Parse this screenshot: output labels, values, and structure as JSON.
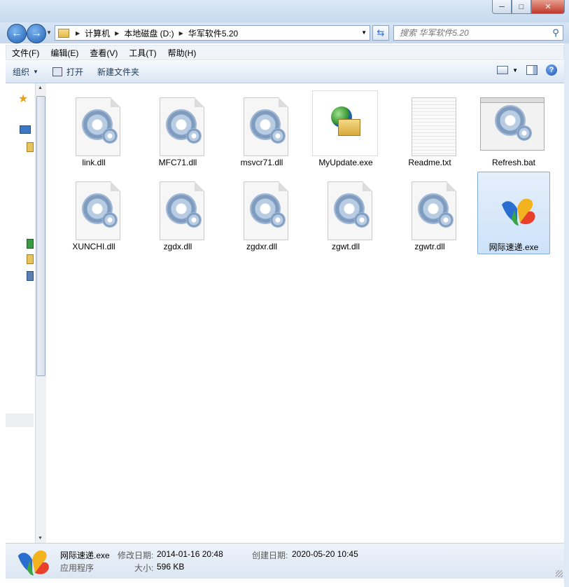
{
  "window": {
    "minimize_label": "─",
    "maximize_label": "□",
    "close_label": "✕"
  },
  "address": {
    "back_icon": "arrow-left-icon",
    "forward_icon": "arrow-right-icon",
    "breadcrumbs": [
      "计算机",
      "本地磁盘 (D:)",
      "华军软件5.20"
    ]
  },
  "search": {
    "placeholder": "搜索 华军软件5.20"
  },
  "menubar": {
    "items": [
      "文件(F)",
      "编辑(E)",
      "查看(V)",
      "工具(T)",
      "帮助(H)"
    ]
  },
  "toolbar": {
    "organize_label": "组织",
    "open_label": "打开",
    "new_folder_label": "新建文件夹"
  },
  "files": [
    {
      "name": "link.dll",
      "type": "dll"
    },
    {
      "name": "MFC71.dll",
      "type": "dll"
    },
    {
      "name": "msvcr71.dll",
      "type": "dll"
    },
    {
      "name": "MyUpdate.exe",
      "type": "exe-update"
    },
    {
      "name": "Readme.txt",
      "type": "txt"
    },
    {
      "name": "Refresh.bat",
      "type": "bat"
    },
    {
      "name": "XUNCHI.dll",
      "type": "dll"
    },
    {
      "name": "zgdx.dll",
      "type": "dll"
    },
    {
      "name": "zgdxr.dll",
      "type": "dll"
    },
    {
      "name": "zgwt.dll",
      "type": "dll"
    },
    {
      "name": "zgwtr.dll",
      "type": "dll"
    },
    {
      "name": "网际速递.exe",
      "type": "exe-msn",
      "selected": true
    }
  ],
  "status": {
    "file_name": "网际速递.exe",
    "file_type": "应用程序",
    "modified_label": "修改日期:",
    "modified_value": "2014-01-16 20:48",
    "created_label": "创建日期:",
    "created_value": "2020-05-20 10:45",
    "size_label": "大小:",
    "size_value": "596 KB"
  },
  "colors": {
    "selection_bg": "#cde2f9",
    "selection_border": "#84acdd",
    "titlebar": "#c6d9ee"
  }
}
